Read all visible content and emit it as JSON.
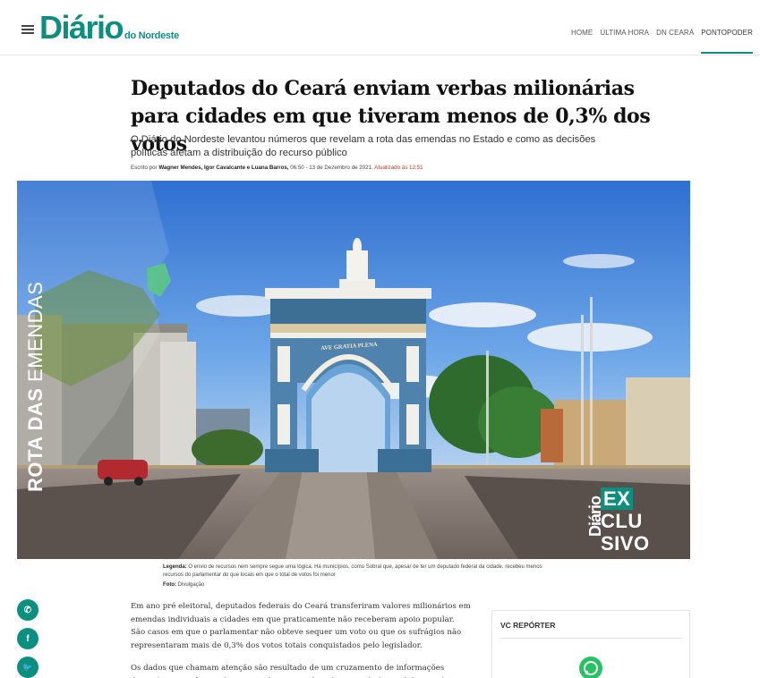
{
  "header": {
    "logo_main": "Diário",
    "logo_sub": "do Nordeste",
    "nav": [
      {
        "label": "HOME"
      },
      {
        "label": "ÚLTIMA HORA"
      },
      {
        "label": "DN CEARÁ"
      },
      {
        "label": "PONTOPODER"
      }
    ],
    "active_nav": "PONTOPODER",
    "accent_color": "#0d8f7f"
  },
  "article": {
    "title": "Deputados do Ceará enviam verbas milionárias para cidades em que tiveram menos de 0,3% dos votos",
    "subtitle": "O Diário do Nordeste levantou números que revelam a rota das emendas no Estado e como as decisões políticas afetam a distribuição do recurso público",
    "byline_prefix": "Escrito por",
    "authors": "Wagner Mendes, Igor Cavalcante e Luana Barros,",
    "published": " 06:50 - 13 de Dezembro de 2021.",
    "updated": " Atualizado às 12:51",
    "hero": {
      "tag_bold": "ROTA DAS",
      "tag_thin": "EMENDAS",
      "arch_inscription": "AVE GRATIA PLENA",
      "badge_brand": "Diário",
      "badge_lines": [
        "EX",
        "CLU",
        "SIVO"
      ]
    },
    "caption": {
      "label": "Legenda:",
      "text": " O envio de recursos nem sempre segue uma lógica. Há municípios, como Sobral que, apesar de ter um deputado federal da cidade, recebeu menos recursos do parlamentar do que locais em que o total de votos foi menor",
      "credit_label": "Foto:",
      "credit": " Divulgação"
    },
    "paragraphs": [
      "Em ano pré  eleitoral, deputados federais do Ceará transferiram valores milionários em emendas individuais a cidades em que praticamente não receberam apoio popular. São casos em que o parlamentar não obteve sequer um voto ou que os sufrágios não representaram mais de 0,3% dos votos totais conquistados pelo legislador.",
      "Os dados que chamam atenção são resultado de um cruzamento de informações disponíveis na Câmara dos Deputados e no Tribunal Regional Eleitoral do Ceará (TRE-"
    ]
  },
  "social": [
    {
      "icon": "whatsapp-icon",
      "glyph": "✆"
    },
    {
      "icon": "facebook-icon",
      "glyph": "f"
    },
    {
      "icon": "twitter-icon",
      "glyph": "🐦"
    }
  ],
  "sidebar": {
    "title": "VC REPÓRTER",
    "icon": "whatsapp-icon"
  }
}
